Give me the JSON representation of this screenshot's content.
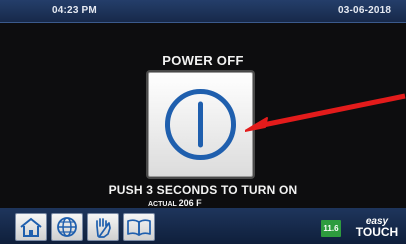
{
  "status_bar": {
    "time": "04:23 PM",
    "date": "03-06-2018"
  },
  "power": {
    "title": "POWER OFF",
    "instruction": "PUSH 3 SECONDS TO TURN ON",
    "actual_label": "ACTUAL",
    "actual_value": "206 F"
  },
  "toolbar": {
    "buttons": [
      {
        "icon": "home-icon"
      },
      {
        "icon": "globe-icon"
      },
      {
        "icon": "hand-icon"
      },
      {
        "icon": "book-icon"
      }
    ],
    "temp_badge": "11.6",
    "brand_line1": "easy",
    "brand_line2": "TOUCH"
  },
  "colors": {
    "accent_blue": "#1f5fae",
    "arrow_red": "#e31b1b",
    "badge_green": "#2e9c3e",
    "bar_blue": "#1e355c"
  }
}
